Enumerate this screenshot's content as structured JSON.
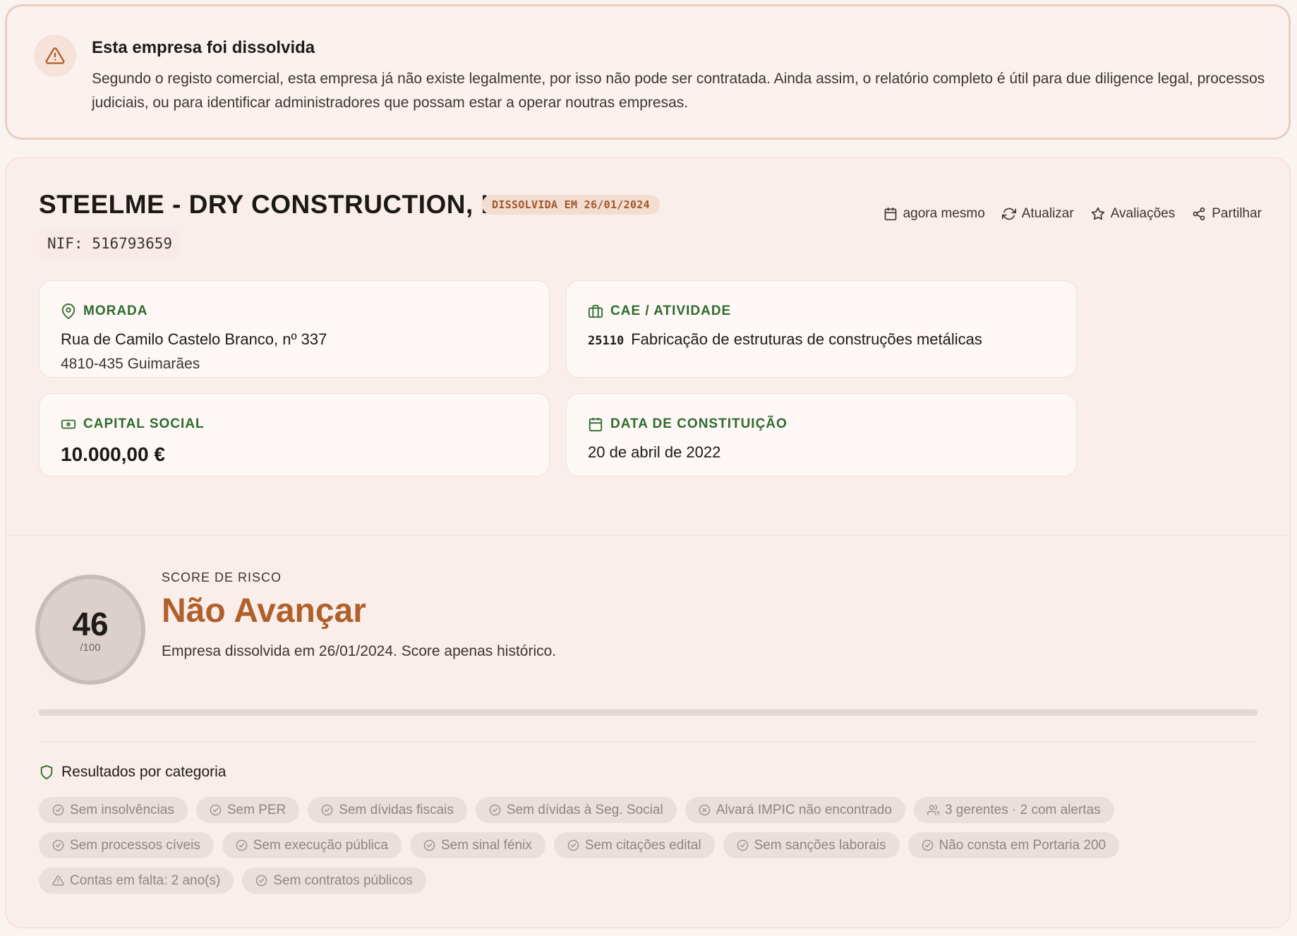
{
  "alert": {
    "icon": "warning-triangle-icon",
    "title": "Esta empresa foi dissolvida",
    "text": "Segundo o registo comercial, esta empresa já não existe legalmente, por isso não pode ser contratada. Ainda assim, o relatório completo é útil para due diligence legal, processos judiciais, ou para identificar administradores que possam estar a operar noutras empresas."
  },
  "company": {
    "name": "STEELME - DRY CONSTRUCTION, LDA",
    "badge": "DISSOLVIDA EM 26/01/2024",
    "nif": "NIF: 516793659"
  },
  "actions": [
    {
      "label": "agora mesmo",
      "icon": "calendar-icon"
    },
    {
      "label": "Atualizar",
      "icon": "refresh-icon"
    },
    {
      "label": "Avaliações",
      "icon": "star-icon"
    },
    {
      "label": "Partilhar",
      "icon": "share-icon"
    }
  ],
  "info": {
    "morada": {
      "label": "MORADA",
      "line1": "Rua de Camilo Castelo Branco, nº 337",
      "line2": "4810-435 Guimarães"
    },
    "cae": {
      "label": "CAE / ATIVIDADE",
      "code": "25110",
      "desc": "Fabricação de estruturas de construções metálicas"
    },
    "capital": {
      "label": "CAPITAL SOCIAL",
      "value": "10.000,00 €"
    },
    "constituicao": {
      "label": "DATA DE CONSTITUIÇÃO",
      "value": "20 de abril de 2022"
    }
  },
  "risk": {
    "label": "SCORE DE RISCO",
    "score": "46",
    "max": "/100",
    "verdict": "Não Avançar",
    "description": "Empresa dissolvida em 26/01/2024. Score apenas histórico.",
    "progress_fraction": 0.0
  },
  "results": {
    "title": "Resultados por categoria",
    "chips": [
      {
        "label": "Sem insolvências",
        "icon": "check-circle-icon"
      },
      {
        "label": "Sem PER",
        "icon": "check-circle-icon"
      },
      {
        "label": "Sem dívidas fiscais",
        "icon": "check-circle-icon"
      },
      {
        "label": "Sem dívidas à Seg. Social",
        "icon": "check-circle-icon"
      },
      {
        "label": "Alvará IMPIC não encontrado",
        "icon": "x-circle-icon"
      },
      {
        "label": "3 gerentes · 2 com alertas",
        "icon": "users-icon"
      },
      {
        "label": "Sem processos cíveis",
        "icon": "check-circle-icon"
      },
      {
        "label": "Sem execução pública",
        "icon": "check-circle-icon"
      },
      {
        "label": "Sem sinal fénix",
        "icon": "check-circle-icon"
      },
      {
        "label": "Sem citações edital",
        "icon": "check-circle-icon"
      },
      {
        "label": "Sem sanções laborais",
        "icon": "check-circle-icon"
      },
      {
        "label": "Não consta em Portaria 200",
        "icon": "check-circle-icon"
      },
      {
        "label": "Contas em falta: 2 ano(s)",
        "icon": "warning-triangle-icon"
      },
      {
        "label": "Sem contratos públicos",
        "icon": "check-circle-icon"
      }
    ]
  },
  "colors": {
    "accent_green": "#2f6b2f",
    "warning_orange": "#b0602a",
    "badge_bg": "#f3dcd0"
  }
}
